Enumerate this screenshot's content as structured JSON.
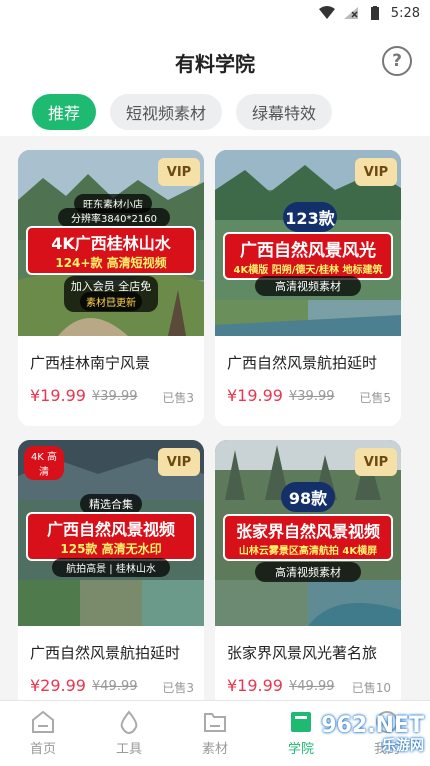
{
  "status_bar": {
    "time": "5:28"
  },
  "header": {
    "title": "有料学院",
    "help_glyph": "?"
  },
  "tabs": [
    {
      "label": "推荐",
      "active": true
    },
    {
      "label": "短视频素材",
      "active": false
    },
    {
      "label": "绿幕特效",
      "active": false
    }
  ],
  "cards": [
    {
      "title": "广西桂林南宁风景",
      "price": "¥19.99",
      "original_price": "¥39.99",
      "sold": "已售3",
      "badge": "VIP",
      "thumb": {
        "top_text": "旺东素材小店",
        "top_sub": "分辨率3840*2160",
        "banner_main": "4K广西桂林山水",
        "banner_sub": "124+款 高清短视频",
        "bottom_text": "加入会员 全店免费",
        "bottom_sub": "素材已更新"
      }
    },
    {
      "title": "广西自然风景航拍延时",
      "price": "¥19.99",
      "original_price": "¥39.99",
      "sold": "已售5",
      "badge": "VIP",
      "thumb": {
        "count": "123款",
        "banner_main": "广西自然风景风光",
        "banner_sub": "4K横版 阳朔/德天/桂林 地标建筑",
        "bottom_text": "高清视频素材"
      }
    },
    {
      "title": "广西自然风景航拍延时",
      "price": "¥29.99",
      "original_price": "¥49.99",
      "sold": "已售3",
      "badge": "VIP",
      "thumb": {
        "corner_text": "4K 高清",
        "top_text": "精选合集",
        "banner_main": "广西自然风景视频",
        "banner_sub": "125款 高清无水印",
        "bottom_text": "航拍高景 | 桂林山水"
      }
    },
    {
      "title": "张家界风景风光著名旅",
      "price": "¥19.99",
      "original_price": "¥49.99",
      "sold": "已售10",
      "badge": "VIP",
      "thumb": {
        "count": "98款",
        "banner_main": "张家界自然风景视频",
        "banner_sub": "山林云雾景区高清航拍 4K横屏",
        "bottom_text": "高清视频素材"
      }
    }
  ],
  "bottom_nav": [
    {
      "label": "首页",
      "icon": "home-icon",
      "active": false
    },
    {
      "label": "工具",
      "icon": "drop-icon",
      "active": false
    },
    {
      "label": "素材",
      "icon": "folder-icon",
      "active": false
    },
    {
      "label": "学院",
      "icon": "book-icon",
      "active": true
    },
    {
      "label": "我的",
      "icon": "user-icon",
      "active": false
    }
  ],
  "watermark": {
    "line1": "962.NET",
    "line2": "乐游网"
  }
}
